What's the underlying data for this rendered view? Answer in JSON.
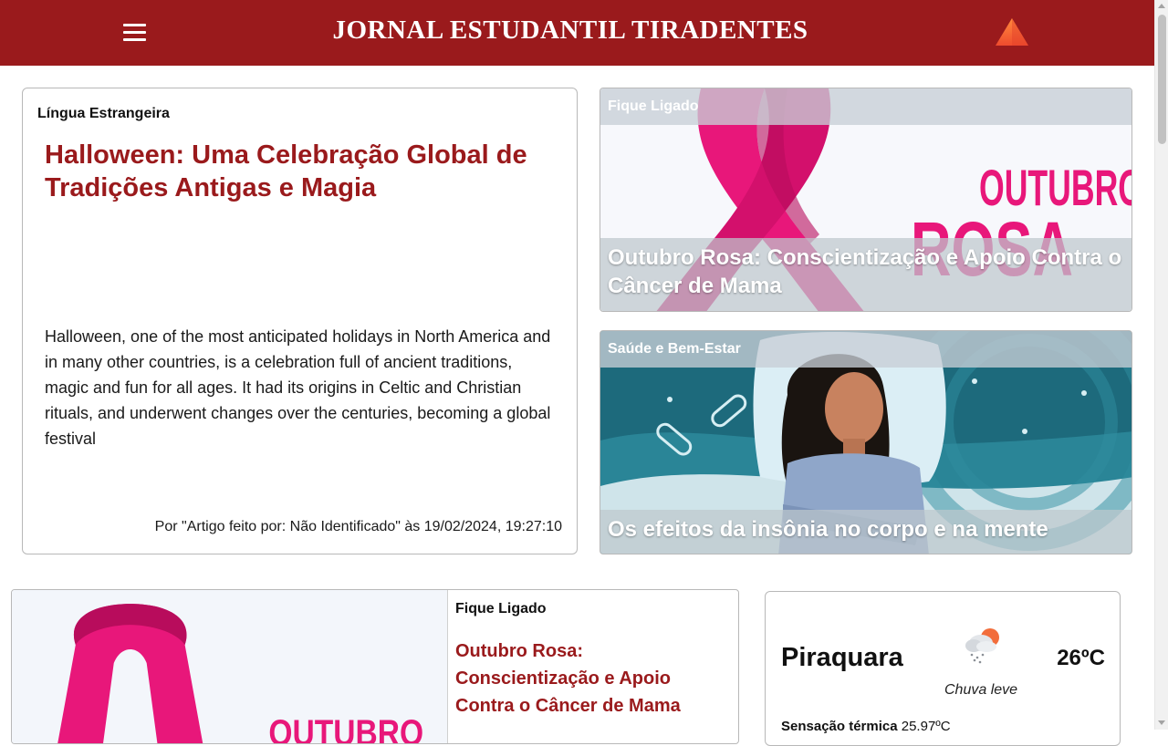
{
  "header": {
    "title": "JORNAL ESTUDANTIL TIRADENTES",
    "menu_icon": "hamburger-icon",
    "logo_icon": "triangle-logo"
  },
  "main_article": {
    "category": "Língua Estrangeira",
    "title": "Halloween: Uma Celebração Global de Tradições Antigas e Magia",
    "summary": "Halloween, one of the most anticipated holidays in North America and in many other countries, is a celebration full of ancient traditions, magic and fun for all ages. It had its origins in Celtic and Christian rituals, and underwent changes over the centuries, becoming a global festival",
    "meta": "Por \"Artigo feito por: Não Identificado\" às 19/02/2024, 19:27:10"
  },
  "side_articles": [
    {
      "category": "Fique Ligado",
      "title": "Outubro Rosa: Conscientização e Apoio Contra o Câncer de Mama",
      "image_text_line1": "OUTUBRO",
      "image_text_line2": "ROSA"
    },
    {
      "category": "Saúde e Bem-Estar",
      "title": "Os efeitos da insônia no corpo e na mente"
    }
  ],
  "bottom_article": {
    "category": "Fique Ligado",
    "title": "Outubro Rosa: Conscientização e Apoio Contra o Câncer de Mama",
    "image_text": "OUTUBRO"
  },
  "weather": {
    "city": "Piraquara",
    "temperature": "26ºC",
    "description": "Chuva leve",
    "feels_label": "Sensação térmica",
    "feels_value": "25.97ºC",
    "icon": "light-rain-icon"
  },
  "colors": {
    "brand": "#9a1a1c",
    "pink": "#e8177a"
  }
}
